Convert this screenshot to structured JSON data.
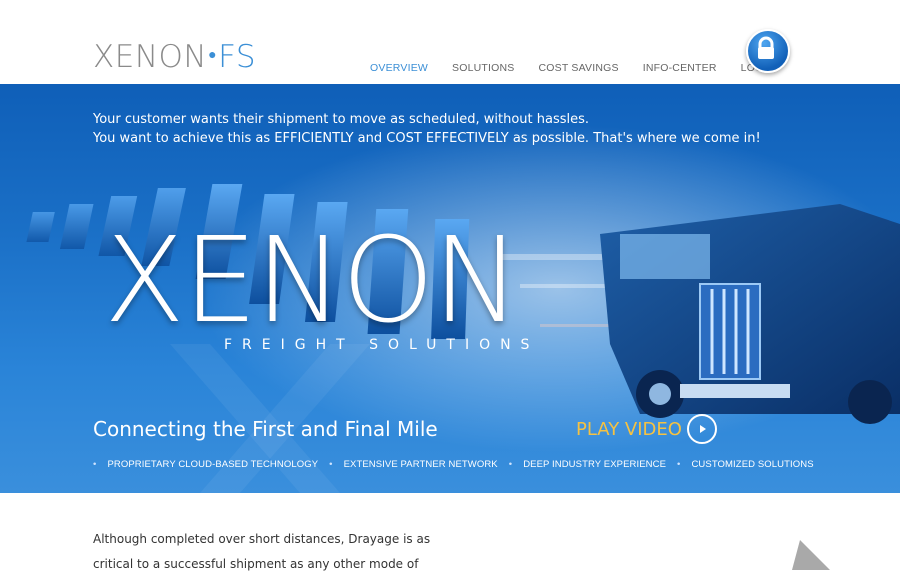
{
  "header": {
    "logo_main": "XENON",
    "logo_suffix": "FS",
    "nav": [
      {
        "label": "OVERVIEW"
      },
      {
        "label": "SOLUTIONS"
      },
      {
        "label": "COST SAVINGS"
      },
      {
        "label": "INFO-CENTER"
      },
      {
        "label": "LOG IN"
      }
    ]
  },
  "hero": {
    "intro_line1": "Your customer wants their shipment to move as scheduled, without hassles.",
    "intro_line2": "You want to achieve this as EFFICIENTLY and COST EFFECTIVELY as possible. That's where we come in!",
    "big_title": "XENON",
    "subtitle": "FREIGHT SOLUTIONS",
    "tagline": "Connecting the First and Final Mile",
    "play_label": "PLAY VIDEO",
    "features": [
      "PROPRIETARY CLOUD-BASED TECHNOLOGY",
      "EXTENSIVE PARTNER NETWORK",
      "DEEP INDUSTRY EXPERIENCE",
      "CUSTOMIZED SOLUTIONS"
    ]
  },
  "body": {
    "paragraph_line1": "Although completed over short distances, Drayage is as",
    "paragraph_line2": "critical to a successful shipment as any other mode of"
  },
  "colors": {
    "accent": "#3b8fd6",
    "hero_blue": "#1a6fc6",
    "play_yellow": "#f5c242"
  },
  "icons": [
    "lock-icon",
    "play-icon"
  ]
}
